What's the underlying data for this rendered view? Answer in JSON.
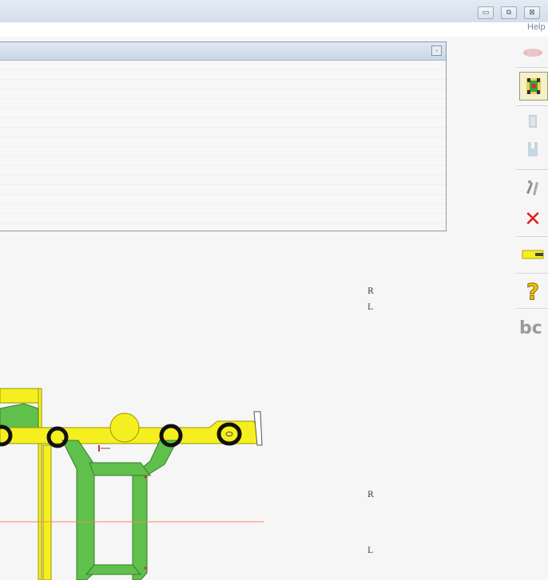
{
  "window": {
    "minimize_glyph": "▭",
    "restore_glyph": "⧉",
    "close_glyph": "⊠"
  },
  "menu": {
    "help_label": "Help"
  },
  "panel": {
    "close_glyph": "▫"
  },
  "toolbar": {
    "items": [
      {
        "icon": "blurred-tool-icon",
        "enabled": false
      },
      {
        "icon": "vehicle-lift-icon",
        "enabled": true,
        "active": true
      },
      {
        "icon": "wheel-clamp-icon",
        "enabled": false
      },
      {
        "icon": "wheel-clamp-alt-icon",
        "enabled": false
      },
      {
        "icon": "steering-icon",
        "enabled": false
      },
      {
        "icon": "delete-icon",
        "glyph": "✕",
        "color": "#e02020",
        "enabled": true
      },
      {
        "icon": "yellow-bar-icon",
        "enabled": true
      },
      {
        "icon": "help-icon",
        "glyph": "?",
        "color": "#f0c000",
        "enabled": true
      },
      {
        "icon": "brand-logo-icon",
        "glyph": "bc",
        "enabled": false
      }
    ]
  },
  "labels": {
    "front_right": "R",
    "front_left": "L",
    "rear_right": "R",
    "rear_left": "L"
  },
  "colors": {
    "chassis_yellow": "#f5ef20",
    "suspension_green": "#5fc14b",
    "guide_line": "#f08a60"
  }
}
